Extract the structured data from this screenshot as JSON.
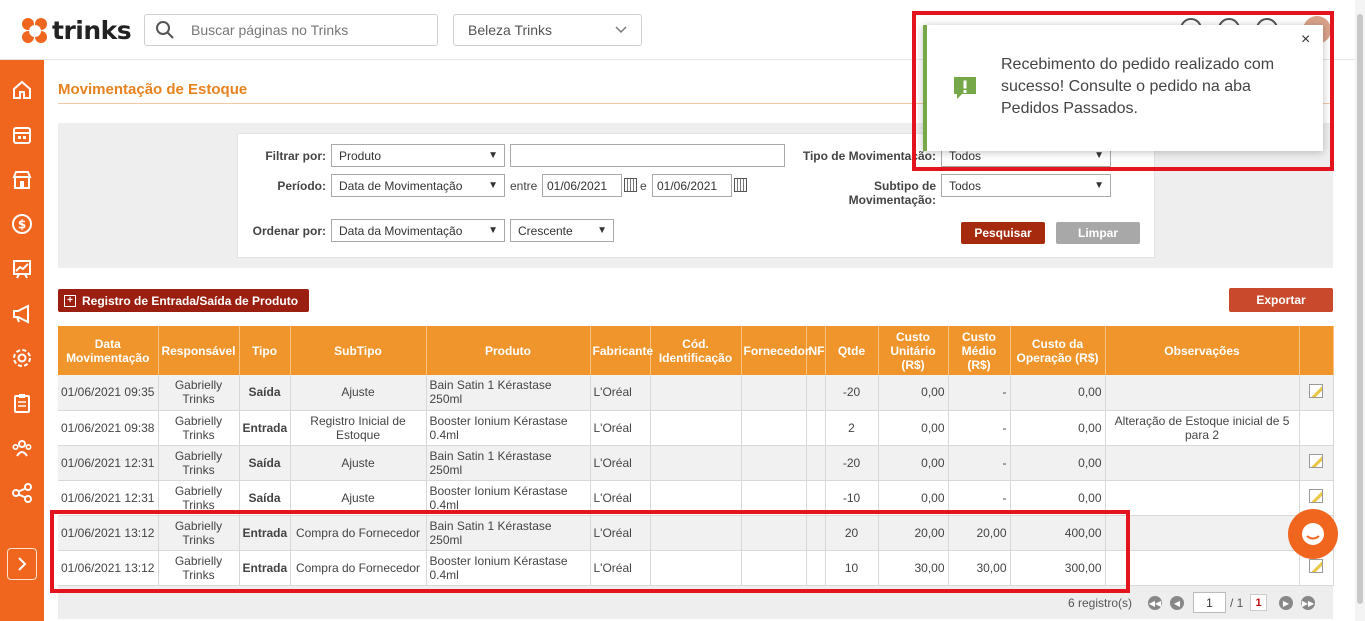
{
  "header": {
    "logo_text": "trinks",
    "search_placeholder": "Buscar páginas no Trinks",
    "company_select": "Beleza Trinks"
  },
  "colors": {
    "brand": "#f0661f",
    "table_header": "#f0952c",
    "highlight": "#e4141e",
    "toast_accent": "#76a84a"
  },
  "sidebar": {
    "items": [
      "home-icon",
      "calendar-icon",
      "store-icon",
      "dollar-icon",
      "chart-icon",
      "megaphone-icon",
      "gear-icon",
      "clipboard-icon",
      "people-icon",
      "share-icon"
    ],
    "expand_icon": "chevron-right-icon"
  },
  "page": {
    "title": "Movimentação de Estoque"
  },
  "filters": {
    "filtrar_label": "Filtrar por:",
    "filtrar_value": "Produto",
    "filtrar_text": "",
    "periodo_label": "Período:",
    "periodo_value": "Data de Movimentação",
    "entre": "entre",
    "date_from": "01/06/2021",
    "e": "e",
    "date_to": "01/06/2021",
    "ordenar_label": "Ordenar por:",
    "ordenar_value": "Data da Movimentação",
    "ordem_value": "Crescente",
    "tipo_label": "Tipo de Movimentação:",
    "tipo_value": "Todos",
    "subtipo_label_1": "Subtipo de",
    "subtipo_label_2": "Movimentação:",
    "subtipo_value": "Todos",
    "pesquisar": "Pesquisar",
    "limpar": "Limpar"
  },
  "actions": {
    "registro": "Registro de Entrada/Saída de Produto",
    "exportar": "Exportar"
  },
  "table": {
    "headers": {
      "data": "Data Movimentação",
      "responsavel": "Responsável",
      "tipo": "Tipo",
      "subtipo": "SubTipo",
      "produto": "Produto",
      "fabricante": "Fabricante",
      "cod": "Cód. Identificação",
      "fornecedor": "Fornecedor",
      "nf": "NF",
      "qtde": "Qtde",
      "custo_unitario": "Custo Unitário (R$)",
      "custo_medio": "Custo Médio (R$)",
      "custo_operacao": "Custo da Operação (R$)",
      "observacoes": "Observações"
    },
    "rows": [
      {
        "data": "01/06/2021 09:35",
        "responsavel": "Gabrielly Trinks",
        "tipo": "Saída",
        "subtipo": "Ajuste",
        "produto": "Bain Satin 1 Kérastase 250ml",
        "fabricante": "L'Oréal",
        "cod": "",
        "fornecedor": "",
        "nf": "",
        "qtde": "-20",
        "custo_unitario": "0,00",
        "custo_medio": "-",
        "custo_operacao": "0,00",
        "observacoes": ""
      },
      {
        "data": "01/06/2021 09:38",
        "responsavel": "Gabrielly Trinks",
        "tipo": "Entrada",
        "subtipo": "Registro Inicial de Estoque",
        "produto": "Booster Ionium Kérastase 0.4ml",
        "fabricante": "L'Oréal",
        "cod": "",
        "fornecedor": "",
        "nf": "",
        "qtde": "2",
        "custo_unitario": "0,00",
        "custo_medio": "-",
        "custo_operacao": "0,00",
        "observacoes": "Alteração de Estoque inicial de 5 para 2"
      },
      {
        "data": "01/06/2021 12:31",
        "responsavel": "Gabrielly Trinks",
        "tipo": "Saída",
        "subtipo": "Ajuste",
        "produto": "Bain Satin 1 Kérastase 250ml",
        "fabricante": "L'Oréal",
        "cod": "",
        "fornecedor": "",
        "nf": "",
        "qtde": "-20",
        "custo_unitario": "0,00",
        "custo_medio": "-",
        "custo_operacao": "0,00",
        "observacoes": ""
      },
      {
        "data": "01/06/2021 12:31",
        "responsavel": "Gabrielly Trinks",
        "tipo": "Saída",
        "subtipo": "Ajuste",
        "produto": "Booster Ionium Kérastase 0.4ml",
        "fabricante": "L'Oréal",
        "cod": "",
        "fornecedor": "",
        "nf": "",
        "qtde": "-10",
        "custo_unitario": "0,00",
        "custo_medio": "-",
        "custo_operacao": "0,00",
        "observacoes": ""
      },
      {
        "data": "01/06/2021 13:12",
        "responsavel": "Gabrielly Trinks",
        "tipo": "Entrada",
        "subtipo": "Compra do Fornecedor",
        "produto": "Bain Satin 1 Kérastase 250ml",
        "fabricante": "L'Oréal",
        "cod": "",
        "fornecedor": "",
        "nf": "",
        "qtde": "20",
        "custo_unitario": "20,00",
        "custo_medio": "20,00",
        "custo_operacao": "400,00",
        "observacoes": ""
      },
      {
        "data": "01/06/2021 13:12",
        "responsavel": "Gabrielly Trinks",
        "tipo": "Entrada",
        "subtipo": "Compra do Fornecedor",
        "produto": "Booster Ionium Kérastase 0.4ml",
        "fabricante": "L'Oréal",
        "cod": "",
        "fornecedor": "",
        "nf": "",
        "qtde": "10",
        "custo_unitario": "30,00",
        "custo_medio": "30,00",
        "custo_operacao": "300,00",
        "observacoes": ""
      }
    ]
  },
  "pagination": {
    "count": "6 registro(s)",
    "page_input": "1",
    "total": "/ 1",
    "current": "1"
  },
  "toast": {
    "message": "Recebimento do pedido realizado com sucesso! Consulte o pedido na aba Pedidos Passados.",
    "close": "×"
  }
}
